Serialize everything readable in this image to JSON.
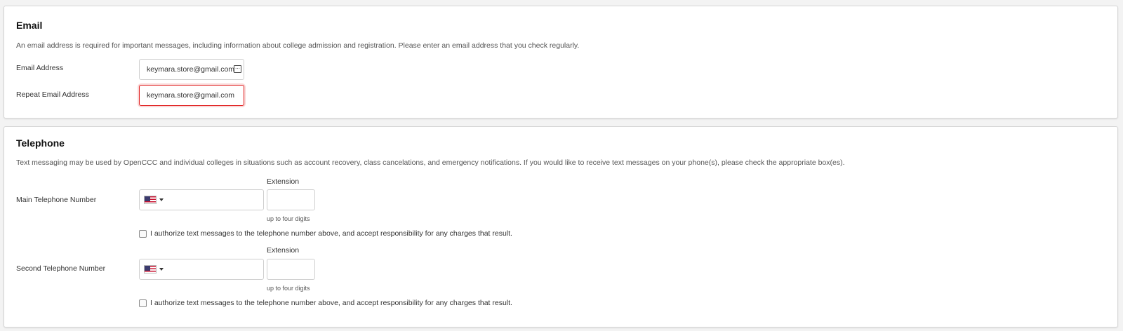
{
  "email": {
    "title": "Email",
    "description": "An email address is required for important messages, including information about college admission and registration. Please enter an email address that you check regularly.",
    "email_address_label": "Email Address",
    "email_address_value": "keymara.store@gmail.com",
    "repeat_email_label": "Repeat Email Address",
    "repeat_email_value": "keymara.store@gmail.com",
    "invalid_color": "#e02020"
  },
  "telephone": {
    "title": "Telephone",
    "description": "Text messaging may be used by OpenCCC and individual colleges in situations such as account recovery, class cancelations, and emergency notifications. If you would like to receive text messages on your phone(s), please check the appropriate box(es).",
    "main": {
      "label": "Main Telephone Number",
      "country_flag": "us-flag-icon",
      "number_value": "",
      "extension_label": "Extension",
      "extension_value": "",
      "extension_hint": "up to four digits",
      "authorize_label": "I authorize text messages to the telephone number above, and accept responsibility for any charges that result.",
      "authorize_checked": false
    },
    "second": {
      "label": "Second Telephone Number",
      "country_flag": "us-flag-icon",
      "number_value": "",
      "extension_label": "Extension",
      "extension_value": "",
      "extension_hint": "up to four digits",
      "authorize_label": "I authorize text messages to the telephone number above, and accept responsibility for any charges that result.",
      "authorize_checked": false
    }
  }
}
